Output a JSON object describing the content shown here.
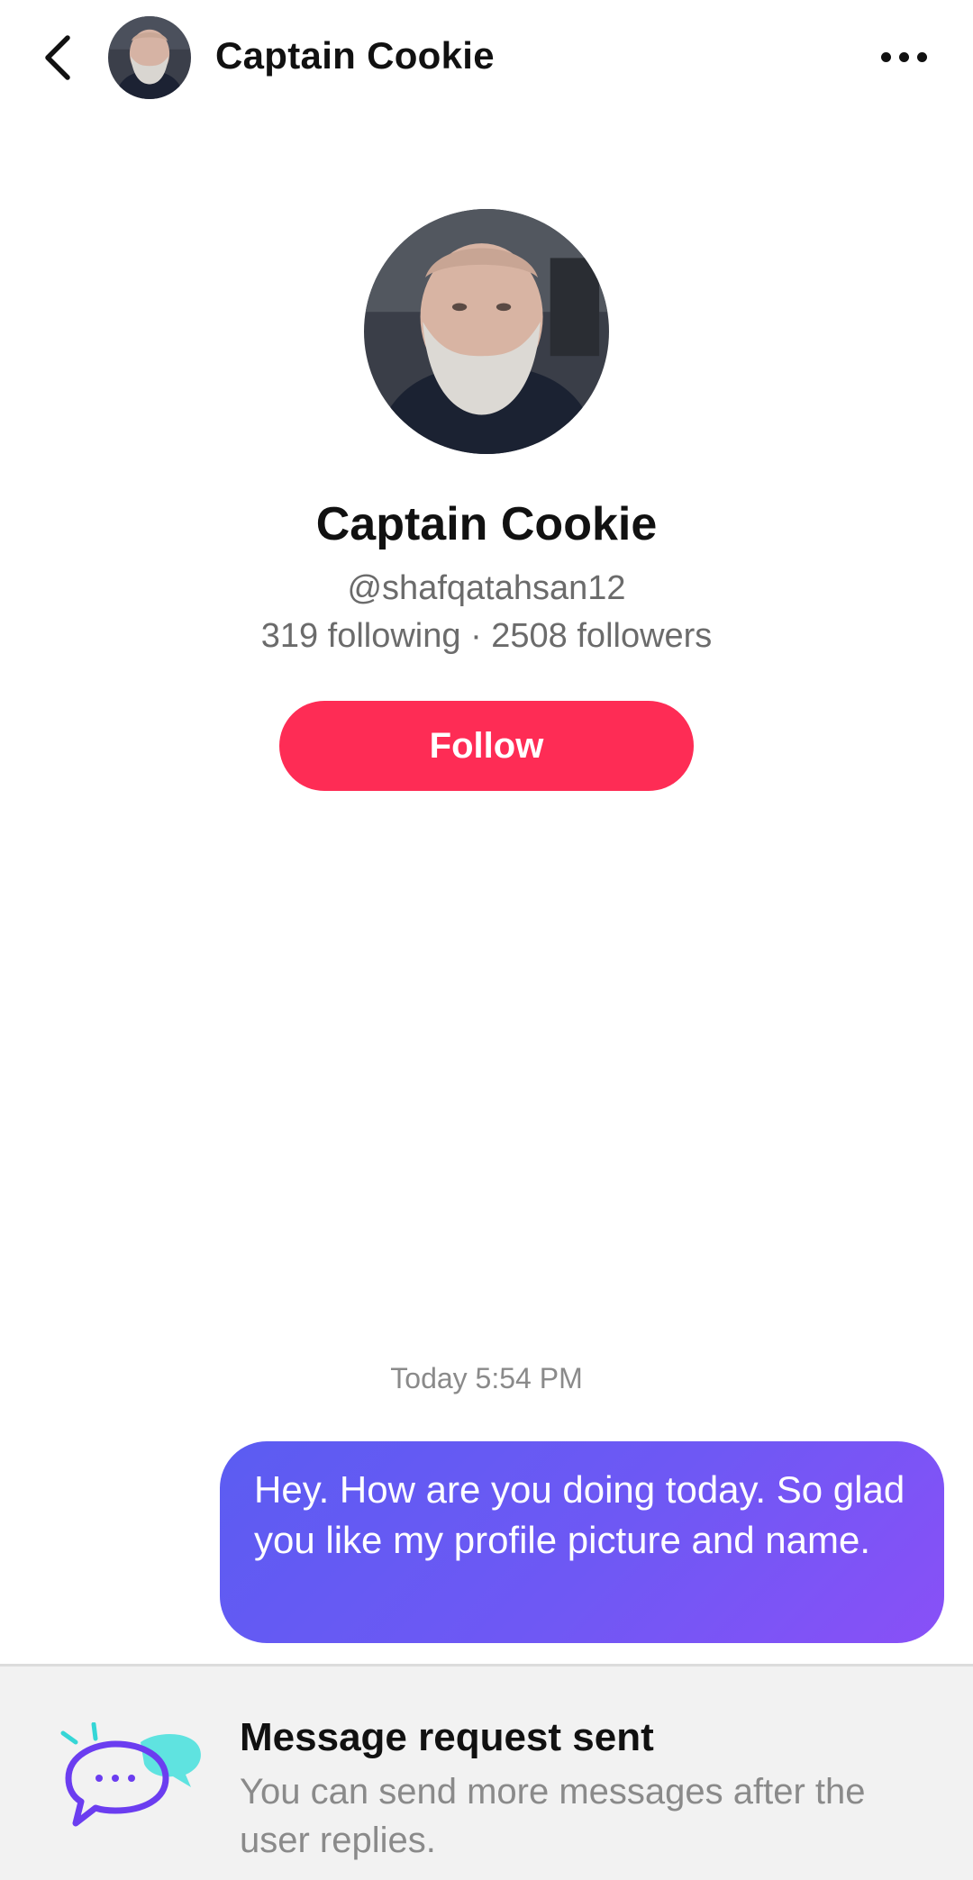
{
  "header": {
    "name": "Captain Cookie",
    "back_icon": "chevron-left-icon",
    "more_icon": "more-horizontal-icon"
  },
  "profile": {
    "name": "Captain Cookie",
    "handle": "@shafqatahsan12",
    "stats": "319 following · 2508 followers",
    "follow_label": "Follow"
  },
  "chat": {
    "timestamp": "Today 5:54 PM",
    "messages": [
      {
        "from": "me",
        "text": "Hey.  How are you doing today.  So glad you like my profile picture and name."
      }
    ]
  },
  "footer": {
    "title": "Message request sent",
    "subtitle": "You can send more messages after the user replies.",
    "icon": "message-request-icon"
  },
  "colors": {
    "follow_button": "#fe2c55",
    "bubble_start": "#5b5cf2",
    "bubble_end": "#8950f7",
    "footer_bg": "#f2f2f2",
    "secondary_text": "#6b6b6b"
  }
}
